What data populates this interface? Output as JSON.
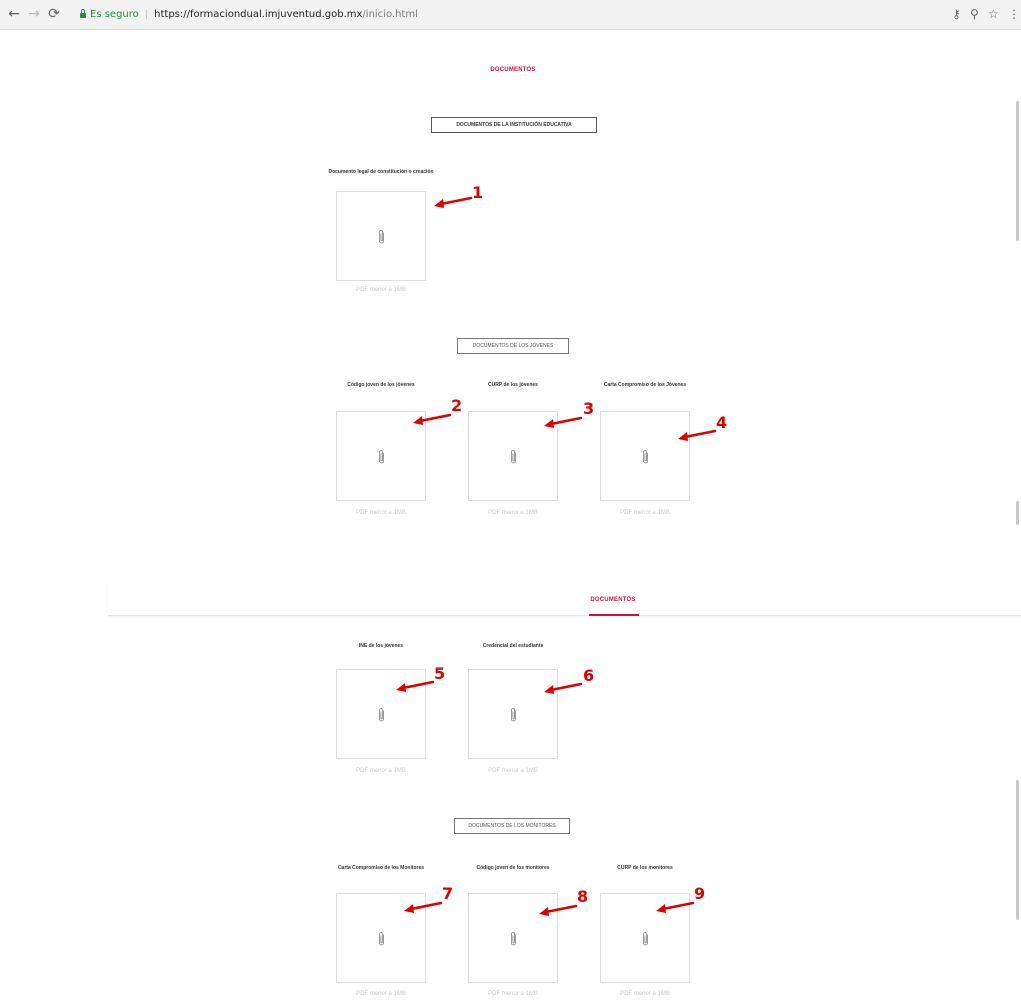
{
  "browser": {
    "secure_label": "Es seguro",
    "url_host": "https://formaciondual.imjuventud.gob.mx",
    "url_path": "/inicio.html"
  },
  "page": {
    "nav_title": "DOCUMENTOS"
  },
  "sections": {
    "institucion": "DOCUMENTOS DE LA INSTITUCIÓN EDUCATIVA",
    "jovenes": "DOCUMENTOS DE LOS JÓVENES",
    "monitores": "DOCUMENTOS DE LOS MONITORES"
  },
  "upload_hint": "PDF menor a 1MB",
  "documents": [
    {
      "label": "Documento legal de constitución o creación",
      "callout": "1"
    },
    {
      "label": "Código joven de los jóvenes",
      "callout": "2"
    },
    {
      "label": "CURP de los jóvenes",
      "callout": "3"
    },
    {
      "label": "Carta Compromiso de los Jóvenes",
      "callout": "4"
    },
    {
      "label": "INE de los jóvenes",
      "callout": "5"
    },
    {
      "label": "Credencial del estudiante",
      "callout": "6"
    },
    {
      "label": "Carta Compromiso de los Monitores",
      "callout": "7"
    },
    {
      "label": "Código joven de los monitores",
      "callout": "8"
    },
    {
      "label": "CURP de los monitores",
      "callout": "9"
    }
  ],
  "colors": {
    "accent": "#c8143c",
    "callout": "#e00000",
    "secure": "#1e8e3e"
  },
  "icons": {
    "back": "arrow-left-icon",
    "forward": "arrow-right-icon",
    "reload": "reload-icon",
    "lock": "lock-icon",
    "key": "key-icon",
    "zoom": "zoom-icon",
    "bookmark": "star-icon",
    "menu": "kebab-menu-icon",
    "upload": "paperclip-icon"
  }
}
